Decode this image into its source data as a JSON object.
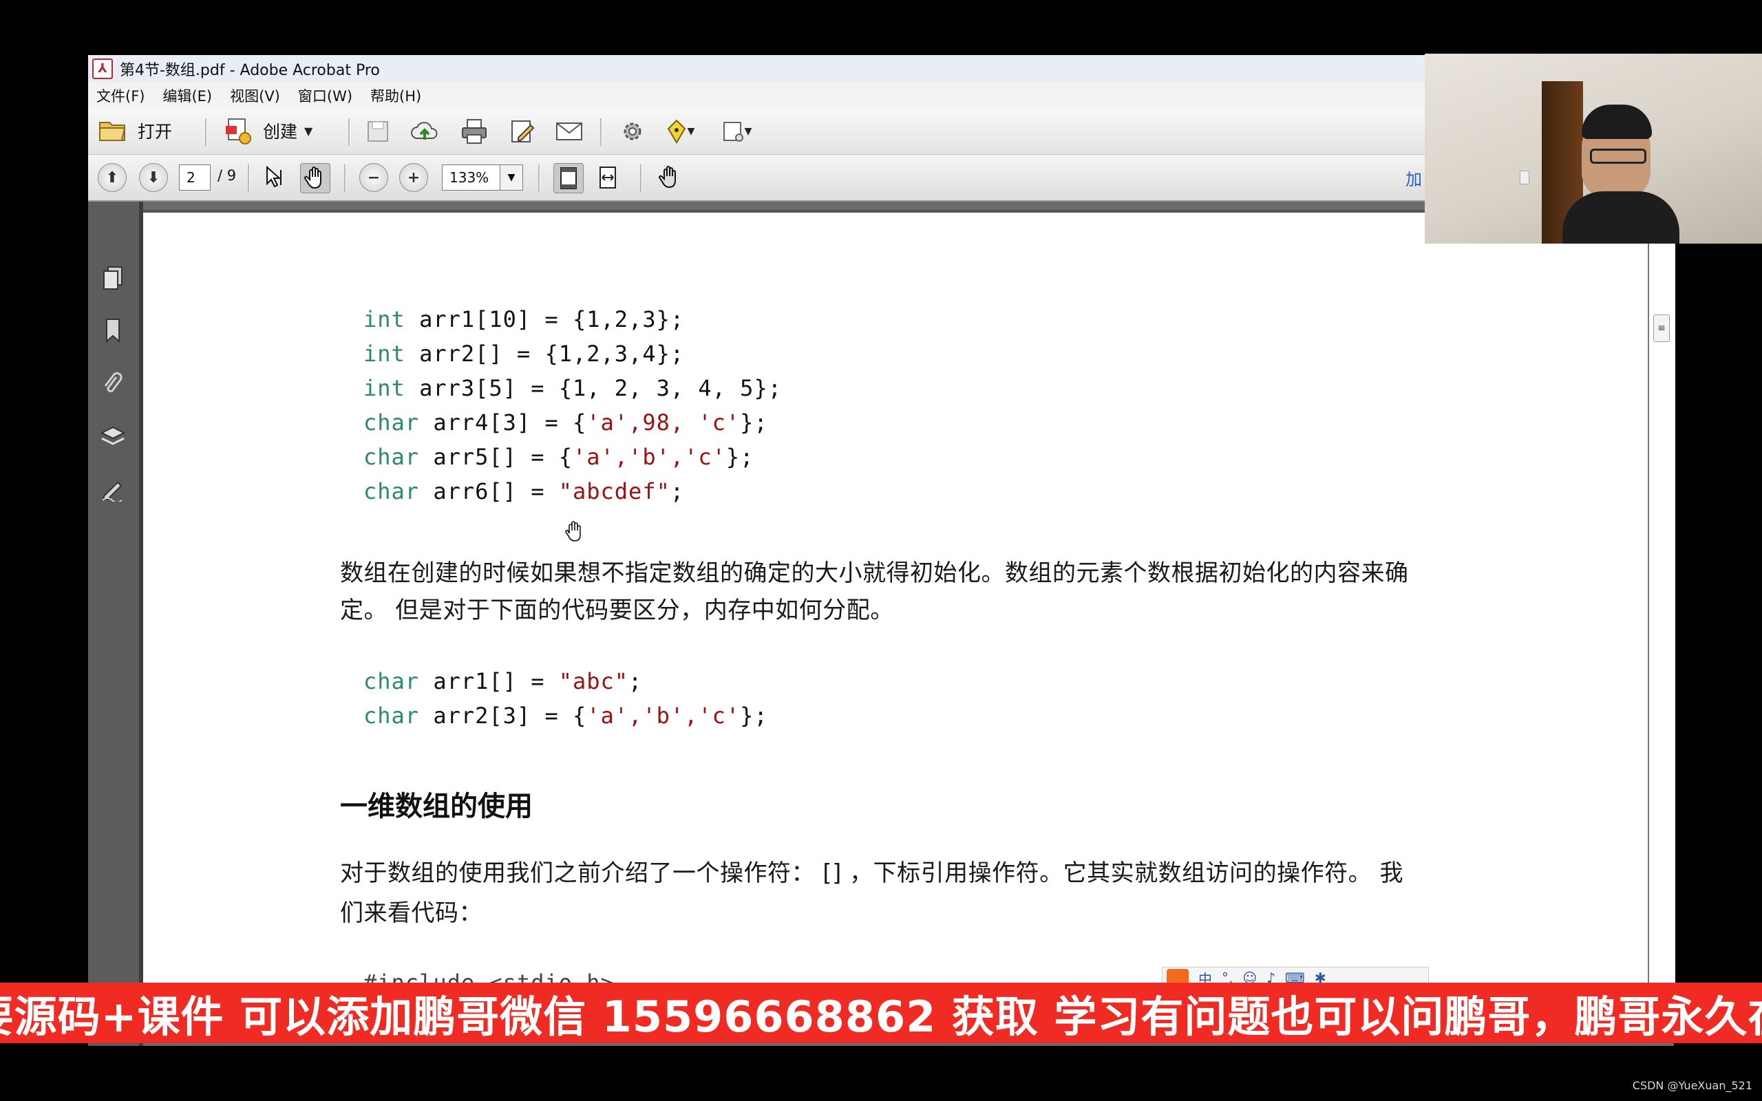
{
  "window": {
    "title": "第4节-数组.pdf - Adobe Acrobat Pro",
    "title_icon": "pdf-icon"
  },
  "menu": [
    "文件(F)",
    "编辑(E)",
    "视图(V)",
    "窗口(W)",
    "帮助(H)"
  ],
  "toolbar": {
    "open_label": "打开",
    "create_label": "创建",
    "page_current": "2",
    "page_total": "/ 9",
    "zoom": "133%",
    "right_label": "加"
  },
  "doc": {
    "code1": [
      {
        "kw": "int",
        "rest_a": " arr1[10] = {1,2,3};",
        "str": "",
        "rest_b": ""
      },
      {
        "kw": "int",
        "rest_a": " arr2[] = {1,2,3,4};",
        "str": "",
        "rest_b": ""
      },
      {
        "kw": "int",
        "rest_a": " arr3[5] = {1, 2, 3, 4, 5};",
        "str": "",
        "rest_b": ""
      },
      {
        "kw": "char",
        "rest_a": " arr4[3] = {",
        "str": "'a',98, 'c'",
        "rest_b": "};"
      },
      {
        "kw": "char",
        "rest_a": " arr5[] = {",
        "str": "'a','b','c'",
        "rest_b": "};"
      },
      {
        "kw": "char",
        "rest_a": " arr6[] = ",
        "str": "\"abcdef\"",
        "rest_b": ";"
      }
    ],
    "para1_line1": "数组在创建的时候如果想不指定数组的确定的大小就得初始化。数组的元素个数根据初始化的内容来确",
    "para1_line2": "定。 但是对于下面的代码要区分，内存中如何分配。",
    "code2": [
      {
        "kw": "char",
        "rest_a": " arr1[] = ",
        "str": "\"abc\"",
        "rest_b": ";"
      },
      {
        "kw": "char",
        "rest_a": " arr2[3] = {",
        "str": "'a','b','c'",
        "rest_b": "};"
      }
    ],
    "heading": "一维数组的使用",
    "para2_line1": "对于数组的使用我们之前介绍了一个操作符： [] ，下标引用操作符。它其实就数组访问的操作符。 我",
    "para2_line2": "们来看代码：",
    "code3_partial": "#include <stdio.h>"
  },
  "banner": "需要源码+课件 可以添加鹏哥微信 15596668862 获取 学习有问题也可以问鹏哥，鹏哥永久在线",
  "credit": "CSDN @YueXuan_521",
  "colors": {
    "banner": "#ef2b23",
    "keyword": "#2b8a6c",
    "string": "#a01010"
  }
}
